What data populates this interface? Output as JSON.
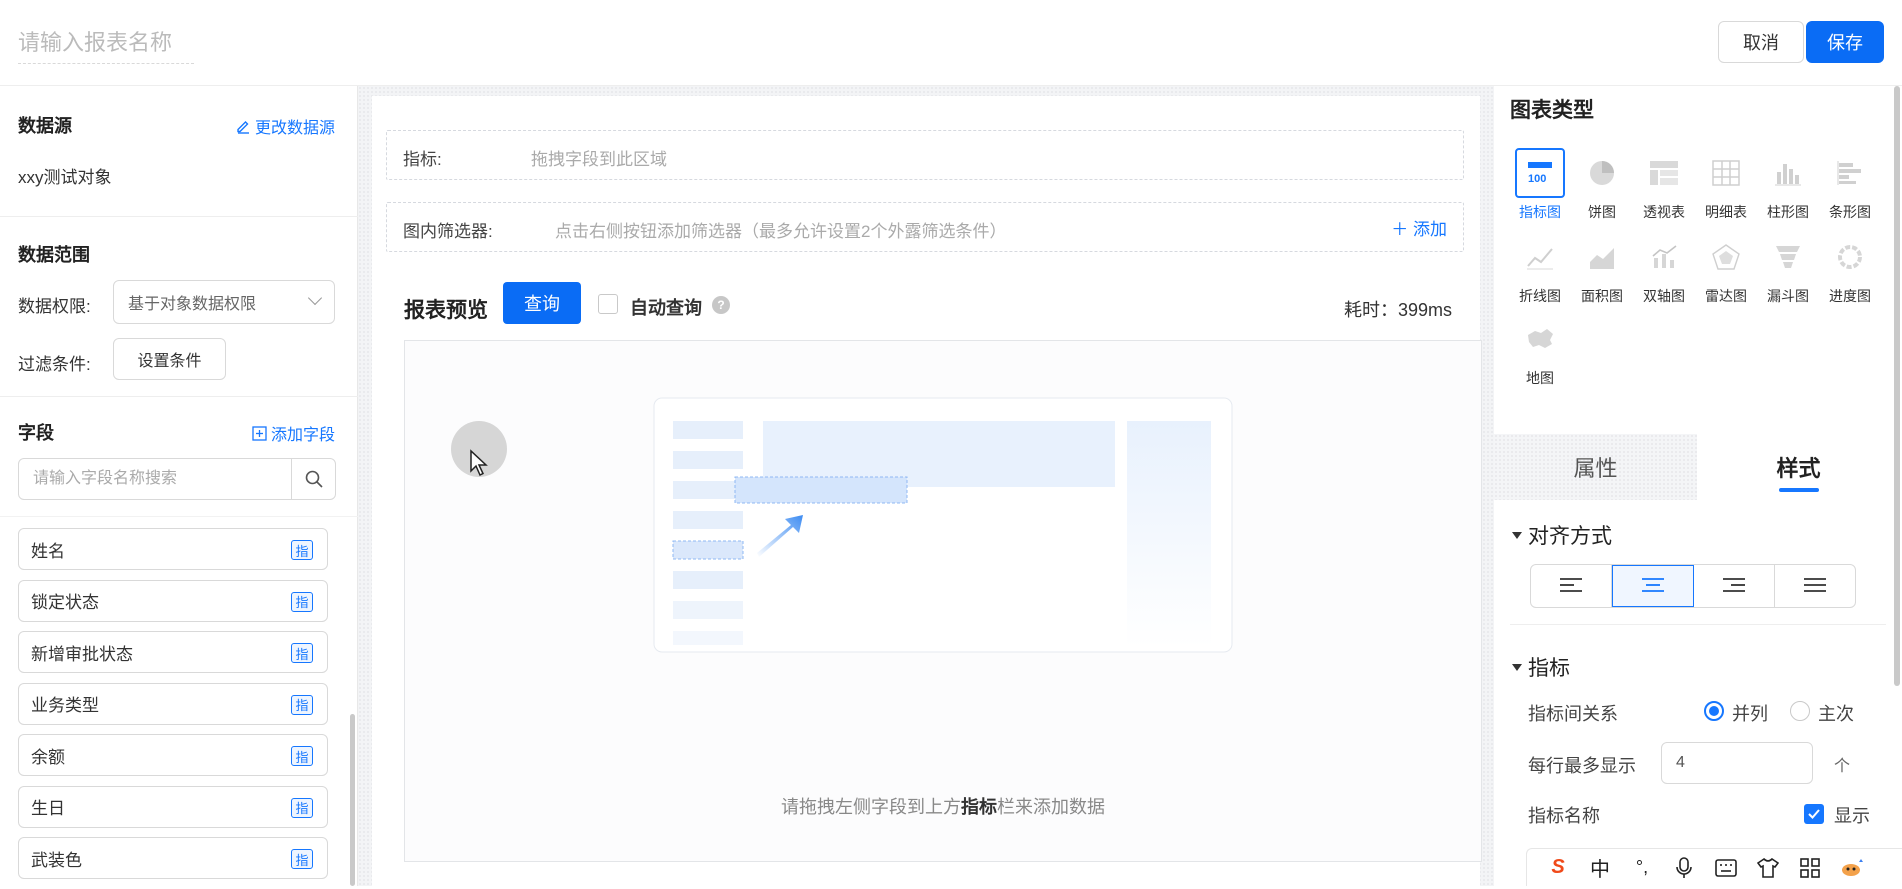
{
  "header": {
    "title_placeholder": "请输入报表名称",
    "cancel": "取消",
    "save": "保存"
  },
  "datasource": {
    "title": "数据源",
    "change_link": "更改数据源",
    "name": "xxy测试对象"
  },
  "datarange": {
    "title": "数据范围",
    "permission_label": "数据权限:",
    "permission_value": "基于对象数据权限",
    "filter_label": "过滤条件:",
    "filter_button": "设置条件"
  },
  "fields": {
    "title": "字段",
    "add_link": "添加字段",
    "search_placeholder": "请输入字段名称搜索",
    "badge": "指",
    "items": [
      "姓名",
      "锁定状态",
      "新增审批状态",
      "业务类型",
      "余额",
      "生日",
      "武装色"
    ]
  },
  "canvas": {
    "metric_label": "指标:",
    "metric_hint": "拖拽字段到此区域",
    "filter_label": "图内筛选器:",
    "filter_hint": "点击右侧按钮添加筛选器（最多允许设置2个外露筛选条件）",
    "filter_add": "添加",
    "preview_title": "报表预览",
    "query_button": "查询",
    "auto_query": "自动查询",
    "elapsed": "耗时：399ms",
    "empty_hint_pre": "请拖拽左侧字段到上方",
    "empty_hint_bold": "指标",
    "empty_hint_post": "栏来添加数据"
  },
  "chart_types": {
    "title": "图表类型",
    "items": [
      "指标图",
      "饼图",
      "透视表",
      "明细表",
      "柱形图",
      "条形图",
      "折线图",
      "面积图",
      "双轴图",
      "雷达图",
      "漏斗图",
      "进度图",
      "地图"
    ],
    "selected": "指标图",
    "indicator_icon_text": "100"
  },
  "panel_tabs": {
    "attributes": "属性",
    "style": "样式",
    "active": "样式"
  },
  "style_panel": {
    "align_title": "对齐方式",
    "align_selected": "center",
    "metric_title": "指标",
    "relation_label": "指标间关系",
    "relation_option_1": "并列",
    "relation_option_2": "主次",
    "relation_selected": "并列",
    "per_row_label": "每行最多显示",
    "per_row_value": "4",
    "per_row_unit": "个",
    "name_label": "指标名称",
    "name_show": "显示",
    "name_show_checked": true
  },
  "ime_toolbar": {
    "logo": "S",
    "mode": "中",
    "punct": "°,"
  },
  "colors": {
    "primary": "#1677ff",
    "save_button": "#0a6cf5"
  }
}
